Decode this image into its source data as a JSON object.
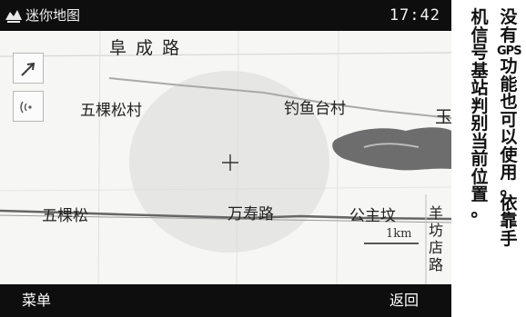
{
  "status_bar": {
    "app_title": "迷你地图",
    "time": "17:42",
    "app_icon": "map-app-icon"
  },
  "map": {
    "controls": [
      {
        "name": "zoom-tool-button",
        "icon": "arrow-cursor-icon"
      },
      {
        "name": "signal-tool-button",
        "icon": "signal-icon"
      }
    ],
    "roads": {
      "top": "阜 成 路",
      "wanshou": "万寿路",
      "yangfangdian": [
        "羊",
        "坊",
        "店",
        "路"
      ]
    },
    "places": {
      "wukesongcun": "五棵松村",
      "diaoyutai": "钓鱼台村",
      "wukesong": "五棵松",
      "gongzhufen": "公主坟",
      "edge": "玉"
    },
    "scale": "1km",
    "position_marker": "crosshair"
  },
  "softkeys": {
    "left": "菜单",
    "right": "返回"
  },
  "caption": [
    "没有GPS功能也可以使用。依靠手",
    "机信号基站判别当前位置。"
  ]
}
